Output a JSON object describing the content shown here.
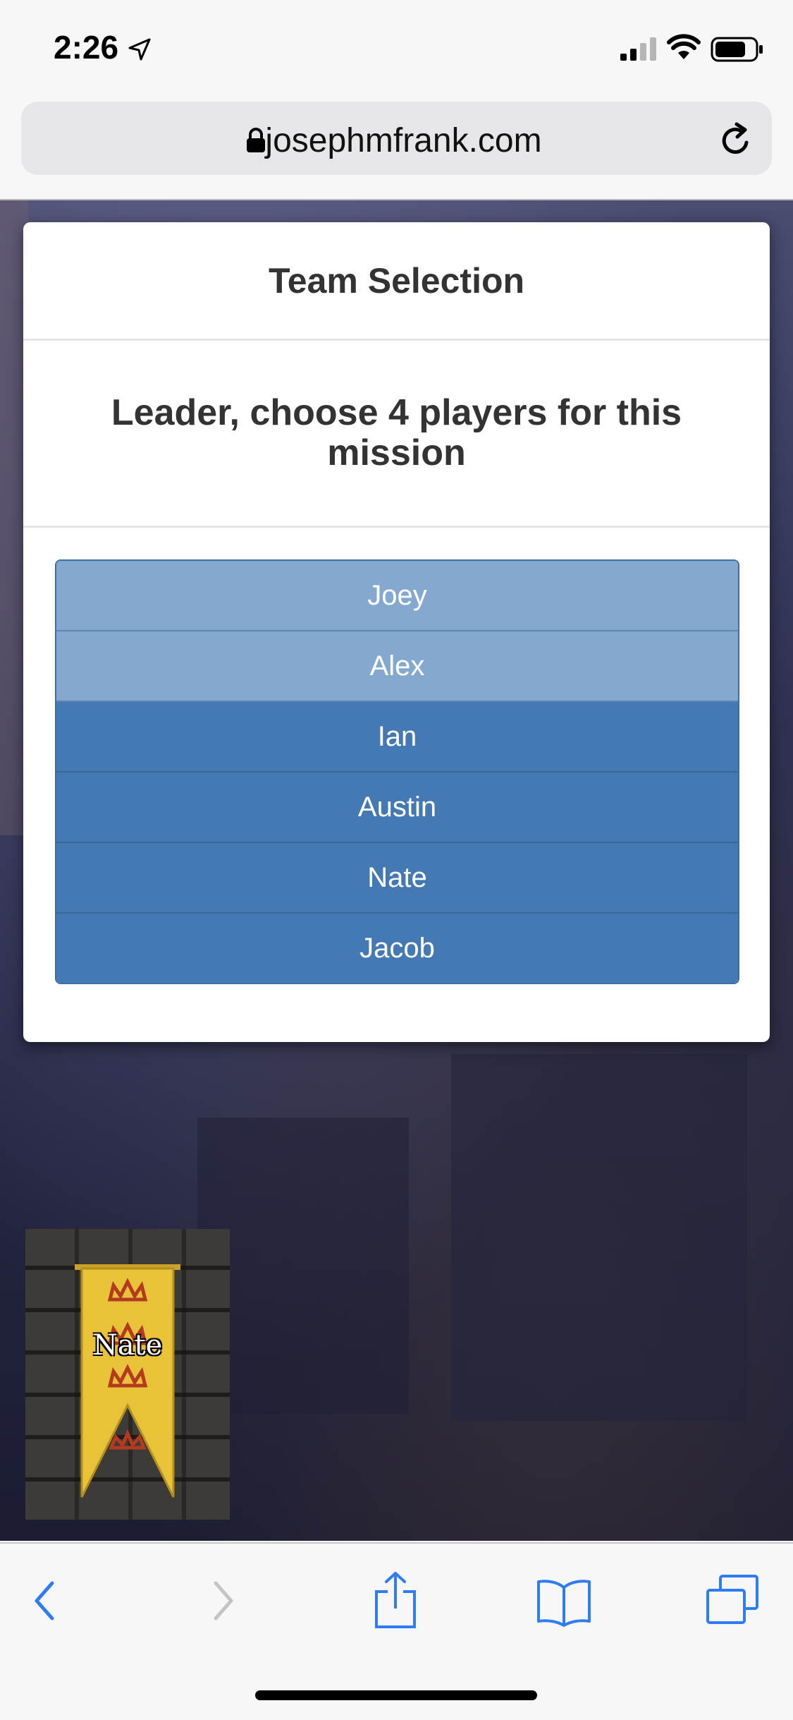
{
  "status_bar": {
    "time": "2:26"
  },
  "browser": {
    "url": "josephmfrank.com"
  },
  "modal": {
    "title": "Team Selection",
    "prompt": "Leader, choose 4 players for this mission",
    "players": [
      {
        "name": "Joey",
        "selected": true
      },
      {
        "name": "Alex",
        "selected": true
      },
      {
        "name": "Ian",
        "selected": false
      },
      {
        "name": "Austin",
        "selected": false
      },
      {
        "name": "Nate",
        "selected": false
      },
      {
        "name": "Jacob",
        "selected": false
      }
    ]
  },
  "player_card": {
    "name": "Nate"
  },
  "colors": {
    "selected_player": "#85a8cf",
    "unselected_player": "#4579b3",
    "banner_yellow": "#e8c33a",
    "toolbar_blue": "#2f7df6"
  }
}
